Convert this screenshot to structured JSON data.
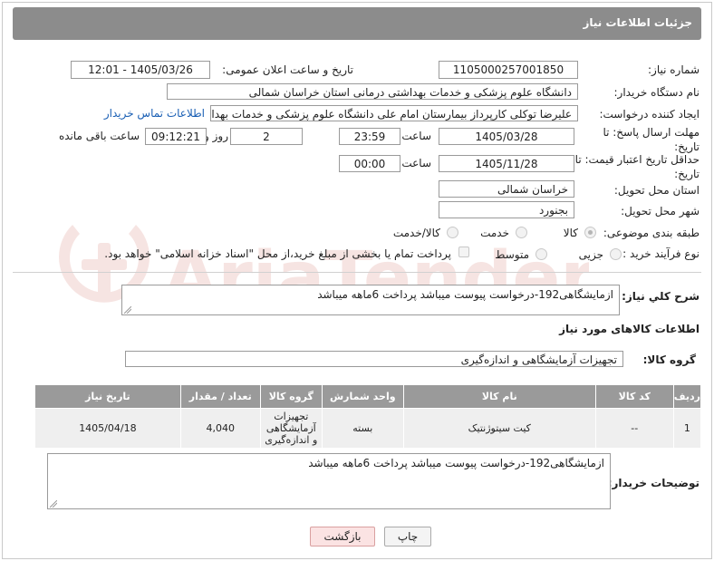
{
  "header": {
    "title": "جزئیات اطلاعات نیاز"
  },
  "fields": {
    "need_number_label": "شماره نیاز:",
    "need_number": "1105000257001850",
    "announce_label": "تاریخ و ساعت اعلان عمومی:",
    "announce_value": "1405/03/26 - 12:01",
    "buyer_org_label": "نام دستگاه خریدار:",
    "buyer_org": "دانشگاه علوم پزشکی و خدمات بهداشتی درمانی استان خراسان شمالی",
    "requester_label": "ایجاد کننده درخواست:",
    "requester": "علیرضا توکلی کارپرداز بیمارستان امام علی دانشگاه علوم پزشکی و خدمات بهدا",
    "contact_link": "اطلاعات تماس خریدار",
    "deadline_label": "مهلت ارسال پاسخ: تا تاریخ:",
    "deadline_date": "1405/03/28",
    "time_label": "ساعت",
    "deadline_time": "23:59",
    "days_value": "2",
    "days_label": "روز و",
    "remaining_time": "09:12:21",
    "remaining_label": "ساعت باقی مانده",
    "min_price_label": "حداقل تاریخ اعتبار قیمت: تا تاریخ:",
    "min_price_date": "1405/11/28",
    "time_label2": "ساعت",
    "min_price_time": "00:00",
    "province_label": "استان محل تحویل:",
    "province": "خراسان شمالی",
    "city_label": "شهر محل تحویل:",
    "city": "بجنورد",
    "category_label": "طبقه بندی موضوعی:",
    "category_options": [
      "کالا",
      "خدمت",
      "کالا/خدمت"
    ],
    "process_label": "نوع فرآیند خرید :",
    "process_options": [
      "جزیی",
      "متوسط"
    ],
    "payment_note": "پرداخت تمام یا بخشی از مبلغ خرید،از محل \"اسناد خزانه اسلامی\" خواهد بود."
  },
  "summary": {
    "label": "شرح کلي نياز:",
    "text": "ازمایشگاهی192-درخواست پیوست میباشد پرداخت 6ماهه میباشد"
  },
  "goods_section": {
    "title": "اطلاعات کالاهای مورد نیاز",
    "group_label": "گروه کالا:",
    "group_value": "تجهیزات آزمایشگاهی و اندازه‌گیری"
  },
  "table": {
    "headers": [
      "ردیف",
      "کد کالا",
      "نام کالا",
      "واحد شمارش",
      "گروه کالا",
      "تعداد / مقدار",
      "تاریخ نیاز"
    ],
    "rows": [
      {
        "row": "1",
        "code": "--",
        "name": "کیت سیتوژنتیک",
        "unit": "بسته",
        "group": "تجهیزات آزمایشگاهی و اندازه‌گیری",
        "qty": "4,040",
        "date": "1405/04/18"
      }
    ]
  },
  "buyer_notes": {
    "label": "توضیحات خریدار:",
    "text": "ازمایشگاهی192-درخواست پیوست میباشد پرداخت 6ماهه میباشد"
  },
  "buttons": {
    "print": "چاپ",
    "back": "بازگشت"
  },
  "colors": {
    "header_bg": "#8c8c8c",
    "link": "#1a5fb4",
    "back_btn_bg": "#fbe3e3",
    "watermark": "#c0392b"
  },
  "watermark": {
    "text": "AriaTender.net"
  }
}
